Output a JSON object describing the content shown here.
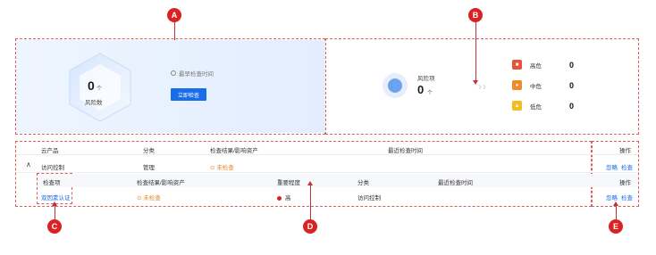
{
  "markers": {
    "a": "A",
    "b": "B",
    "c": "C",
    "d": "D",
    "e": "E"
  },
  "scan_card": {
    "risk_value": "0",
    "risk_unit": "个",
    "risk_label": "风险数",
    "last_scan_label": "最早检查时间",
    "scan_button": "立即检查"
  },
  "risk_panel": {
    "title": "风险项",
    "count": "0",
    "unit": "个",
    "levels": [
      {
        "label": "高危",
        "value": "0",
        "color": "#e5533d",
        "icon": "high-risk-icon"
      },
      {
        "label": "中危",
        "value": "0",
        "color": "#f08a2b",
        "icon": "medium-risk-icon"
      },
      {
        "label": "低危",
        "value": "0",
        "color": "#f3bd1d",
        "icon": "low-risk-icon"
      }
    ]
  },
  "table": {
    "headers": {
      "product": "云产品",
      "category": "分类",
      "result": "检查结果/影响资产",
      "last_check": "最近检查时间",
      "action": "操作"
    },
    "row": {
      "product": "访问控制",
      "category": "管理",
      "result": "未检查",
      "actions": [
        "忽略",
        "检查"
      ]
    },
    "sub_headers": {
      "item": "检查项",
      "result": "检查结果/影响资产",
      "severity": "重要程度",
      "category": "分类",
      "last_check": "最近检查时间",
      "action": "操作"
    },
    "sub_row": {
      "item": "双因素认证",
      "result": "未检查",
      "severity": "高",
      "category": "访问控制",
      "actions": [
        "忽略",
        "检查"
      ]
    }
  }
}
